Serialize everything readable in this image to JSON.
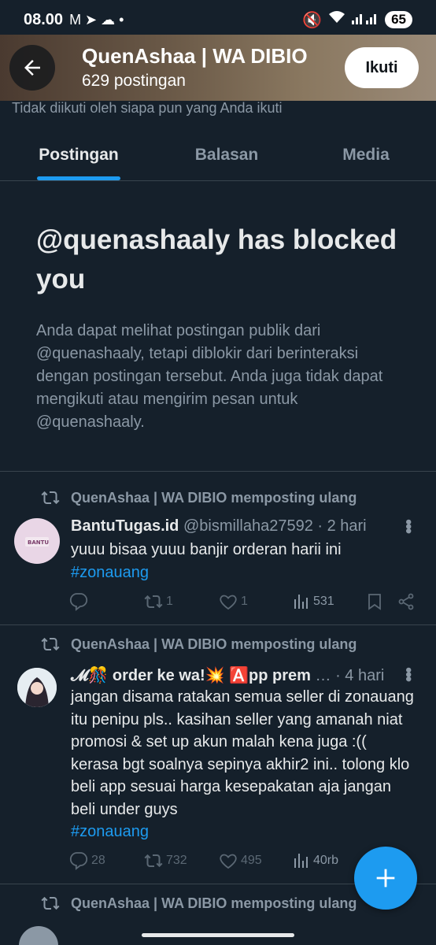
{
  "status_bar": {
    "time": "08.00",
    "battery": "65"
  },
  "header": {
    "title": "QuenAshaa | WA DIBIO",
    "post_count": "629 postingan",
    "follow_label": "Ikuti"
  },
  "not_followed_text": "Tidak diikuti oleh siapa pun yang Anda ikuti",
  "tabs": [
    {
      "label": "Postingan",
      "active": true
    },
    {
      "label": "Balasan",
      "active": false
    },
    {
      "label": "Media",
      "active": false
    }
  ],
  "blocked": {
    "title": "@quenashaaly has blocked you",
    "message": "Anda dapat melihat postingan publik dari @quenashaaly, tetapi diblokir dari berinteraksi dengan postingan tersebut. Anda juga tidak dapat mengikuti atau mengirim pesan untuk @quenashaaly."
  },
  "posts": [
    {
      "repost_label": "QuenAshaa | WA DIBIO memposting ulang",
      "name": "BantuTugas.id",
      "handle": "@bismillaha27592",
      "time": "· 2 hari",
      "text": "yuuu bisaa yuuu banjir orderan harii ini",
      "hashtag": "#zonauang",
      "replies": "",
      "reposts": "1",
      "likes": "1",
      "views": "531"
    },
    {
      "repost_label": "QuenAshaa | WA DIBIO memposting ulang",
      "name": "𝓜🎊 order ke wa!💥 🅰️pp prem",
      "handle": "…",
      "time": "· 4 hari",
      "text": "jangan disama ratakan semua seller di zonauang itu penipu pls.. kasihan seller yang amanah niat promosi & set up akun malah kena juga :(( kerasa bgt soalnya sepinya akhir2 ini.. tolong klo beli app sesuai harga kesepakatan aja jangan beli under guys",
      "hashtag": "#zonauang",
      "replies": "28",
      "reposts": "732",
      "likes": "495",
      "views": "40rb"
    },
    {
      "repost_label": "QuenAshaa | WA DIBIO memposting ulang"
    }
  ],
  "colors": {
    "accent": "#1d9bf0",
    "background": "#15202b"
  }
}
